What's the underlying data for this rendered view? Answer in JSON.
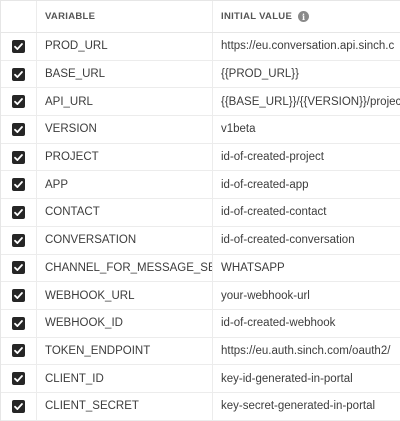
{
  "header": {
    "variable_label": "VARIABLE",
    "initial_value_label": "INITIAL VALUE",
    "info_icon": "i"
  },
  "rows": [
    {
      "checked": true,
      "name": "PROD_URL",
      "value": "https://eu.conversation.api.sinch.c"
    },
    {
      "checked": true,
      "name": "BASE_URL",
      "value": "{{PROD_URL}}"
    },
    {
      "checked": true,
      "name": "API_URL",
      "value": "{{BASE_URL}}/{{VERSION}}/project"
    },
    {
      "checked": true,
      "name": "VERSION",
      "value": "v1beta"
    },
    {
      "checked": true,
      "name": "PROJECT",
      "value": "id-of-created-project"
    },
    {
      "checked": true,
      "name": "APP",
      "value": "id-of-created-app"
    },
    {
      "checked": true,
      "name": "CONTACT",
      "value": "id-of-created-contact"
    },
    {
      "checked": true,
      "name": "CONVERSATION",
      "value": "id-of-created-conversation"
    },
    {
      "checked": true,
      "name": "CHANNEL_FOR_MESSAGE_SEND",
      "value": "WHATSAPP"
    },
    {
      "checked": true,
      "name": "WEBHOOK_URL",
      "value": "your-webhook-url"
    },
    {
      "checked": true,
      "name": "WEBHOOK_ID",
      "value": "id-of-created-webhook"
    },
    {
      "checked": true,
      "name": "TOKEN_ENDPOINT",
      "value": "https://eu.auth.sinch.com/oauth2/"
    },
    {
      "checked": true,
      "name": "CLIENT_ID",
      "value": "key-id-generated-in-portal"
    },
    {
      "checked": true,
      "name": "CLIENT_SECRET",
      "value": "key-secret-generated-in-portal"
    }
  ]
}
